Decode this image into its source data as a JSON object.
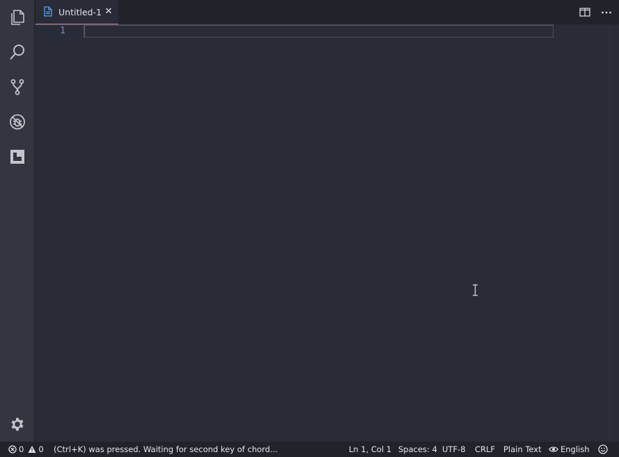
{
  "activity_bar": {
    "items": [
      "explorer-icon",
      "search-icon",
      "source-control-icon",
      "debug-icon",
      "extensions-icon"
    ],
    "bottom": "gear-icon"
  },
  "tabs": [
    {
      "label": "Untitled-1",
      "icon": "file-icon",
      "close": "✕",
      "active": true
    }
  ],
  "tab_actions": [
    "split-editor-icon",
    "more-actions-icon"
  ],
  "editor": {
    "line_numbers": [
      "1"
    ],
    "content": ""
  },
  "statusbar": {
    "errors": "0",
    "warnings": "0",
    "message": "(Ctrl+K) was pressed. Waiting for second key of chord...",
    "position": "Ln 1, Col 1",
    "indentation": "Spaces: 4",
    "encoding": "UTF-8",
    "eol": "CRLF",
    "language": "Plain Text",
    "spell_language": "English",
    "feedback_icon": "smiley-icon"
  },
  "colors": {
    "accent_tab_border": "#c778a8",
    "editor_bg": "#292b36",
    "activity_bg": "#33353f",
    "line_number": "#7b8ab8"
  }
}
